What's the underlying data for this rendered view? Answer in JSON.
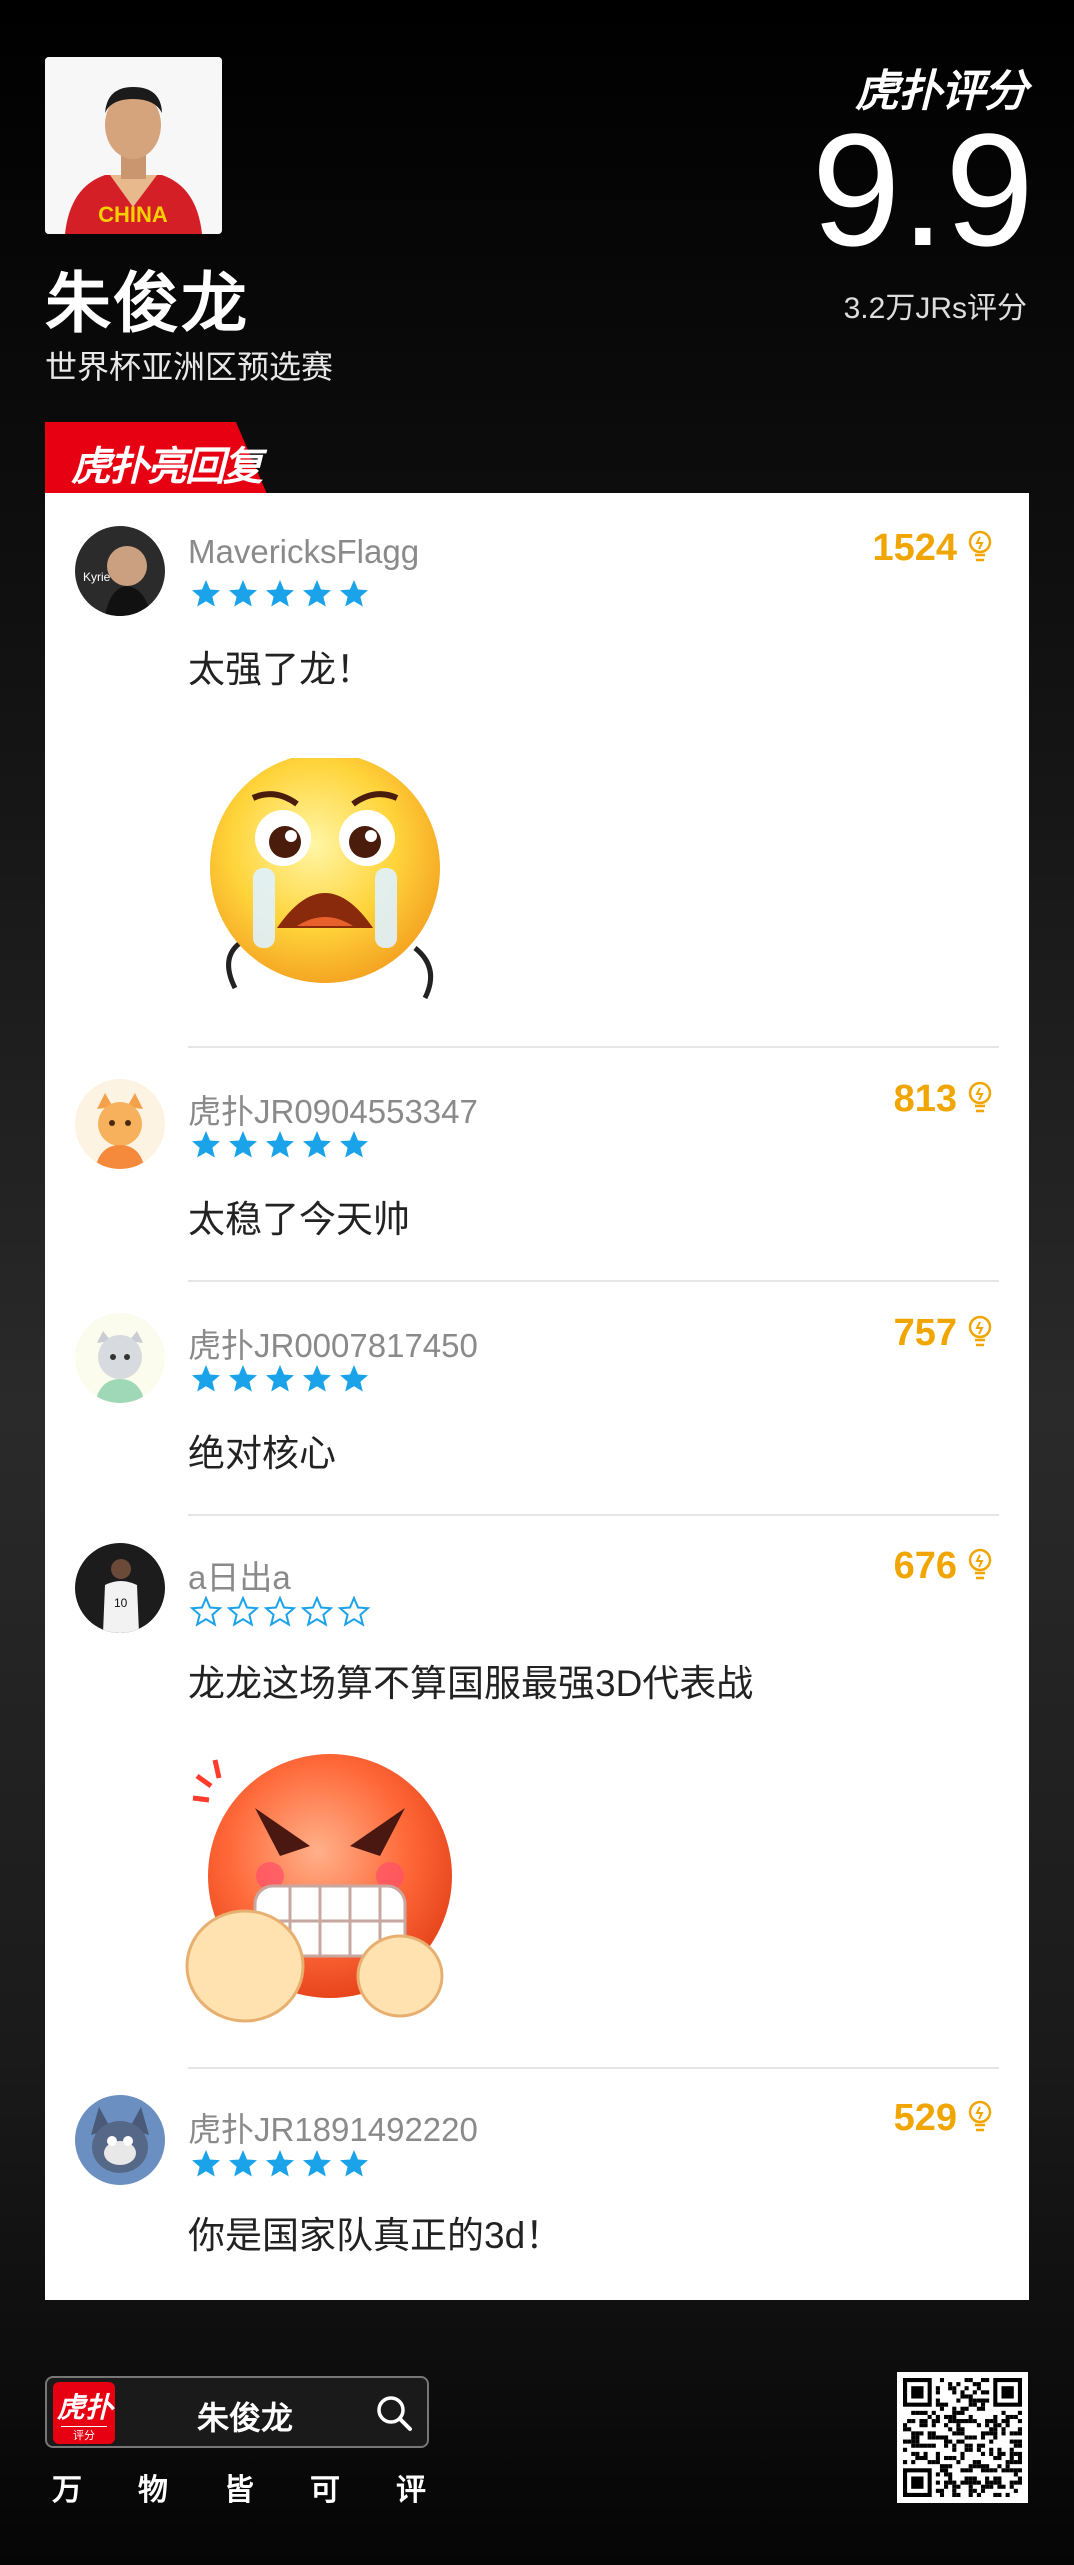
{
  "header": {
    "player_name": "朱俊龙",
    "event": "世界杯亚洲区预选赛",
    "brand": "虎扑评分",
    "score": "9.9",
    "votes": "3.2万JRs评分",
    "jersey_text": "CHINA"
  },
  "section_tag": "虎扑亮回复",
  "comments": [
    {
      "user": "MavericksFlagg",
      "stars": 5,
      "likes": "1524",
      "text": "太强了龙！",
      "emoji": "crying-face-emoji"
    },
    {
      "user": "虎扑JR0904553347",
      "stars": 5,
      "likes": "813",
      "text": "太稳了今天帅"
    },
    {
      "user": "虎扑JR0007817450",
      "stars": 5,
      "likes": "757",
      "text": "绝对核心"
    },
    {
      "user": "a日出a",
      "stars": 0,
      "likes": "676",
      "text": "龙龙这场算不算国服最强3D代表战",
      "emoji": "angry-face-emoji"
    },
    {
      "user": "虎扑JR1891492220",
      "stars": 5,
      "likes": "529",
      "text": "你是国家队真正的3d！"
    }
  ],
  "footer": {
    "app_icon_text": "虎扑",
    "app_icon_sub": "评分",
    "search_text": "朱俊龙",
    "slogan": [
      "万",
      "物",
      "皆",
      "可",
      "评"
    ]
  },
  "colors": {
    "accent_red": "#e60012",
    "star_blue": "#1aa3e8",
    "likes_gold": "#f0a500"
  }
}
